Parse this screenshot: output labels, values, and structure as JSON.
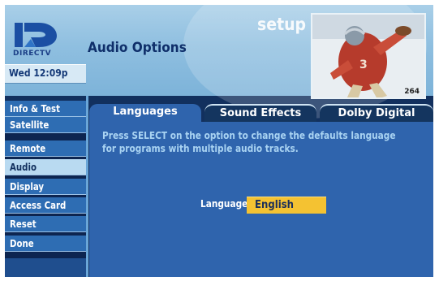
{
  "brand": {
    "logo_text": "DIRECTV"
  },
  "header": {
    "title": "Audio Options",
    "section": "setup",
    "datetime": "Wed 12:09p"
  },
  "preview": {
    "channel": "264"
  },
  "sidebar": {
    "items": [
      {
        "label": "Info & Test"
      },
      {
        "label": "Satellite"
      },
      {
        "label": "Remote"
      },
      {
        "label": "Audio"
      },
      {
        "label": "Display"
      },
      {
        "label": "Access Card"
      },
      {
        "label": "Reset"
      },
      {
        "label": "Done"
      }
    ],
    "active": "Audio"
  },
  "tabs": [
    {
      "label": "Languages"
    },
    {
      "label": "Sound Effects"
    },
    {
      "label": "Dolby Digital"
    }
  ],
  "main": {
    "description": "Press SELECT on the option to change the defaults language\nfor programs with multiple audio tracks.",
    "language_label": "Language:",
    "language_value": "English"
  },
  "colors": {
    "background": "#12305e",
    "accent": "#2f64ad",
    "highlight": "#f4c232",
    "header": "#8fbfe0"
  }
}
